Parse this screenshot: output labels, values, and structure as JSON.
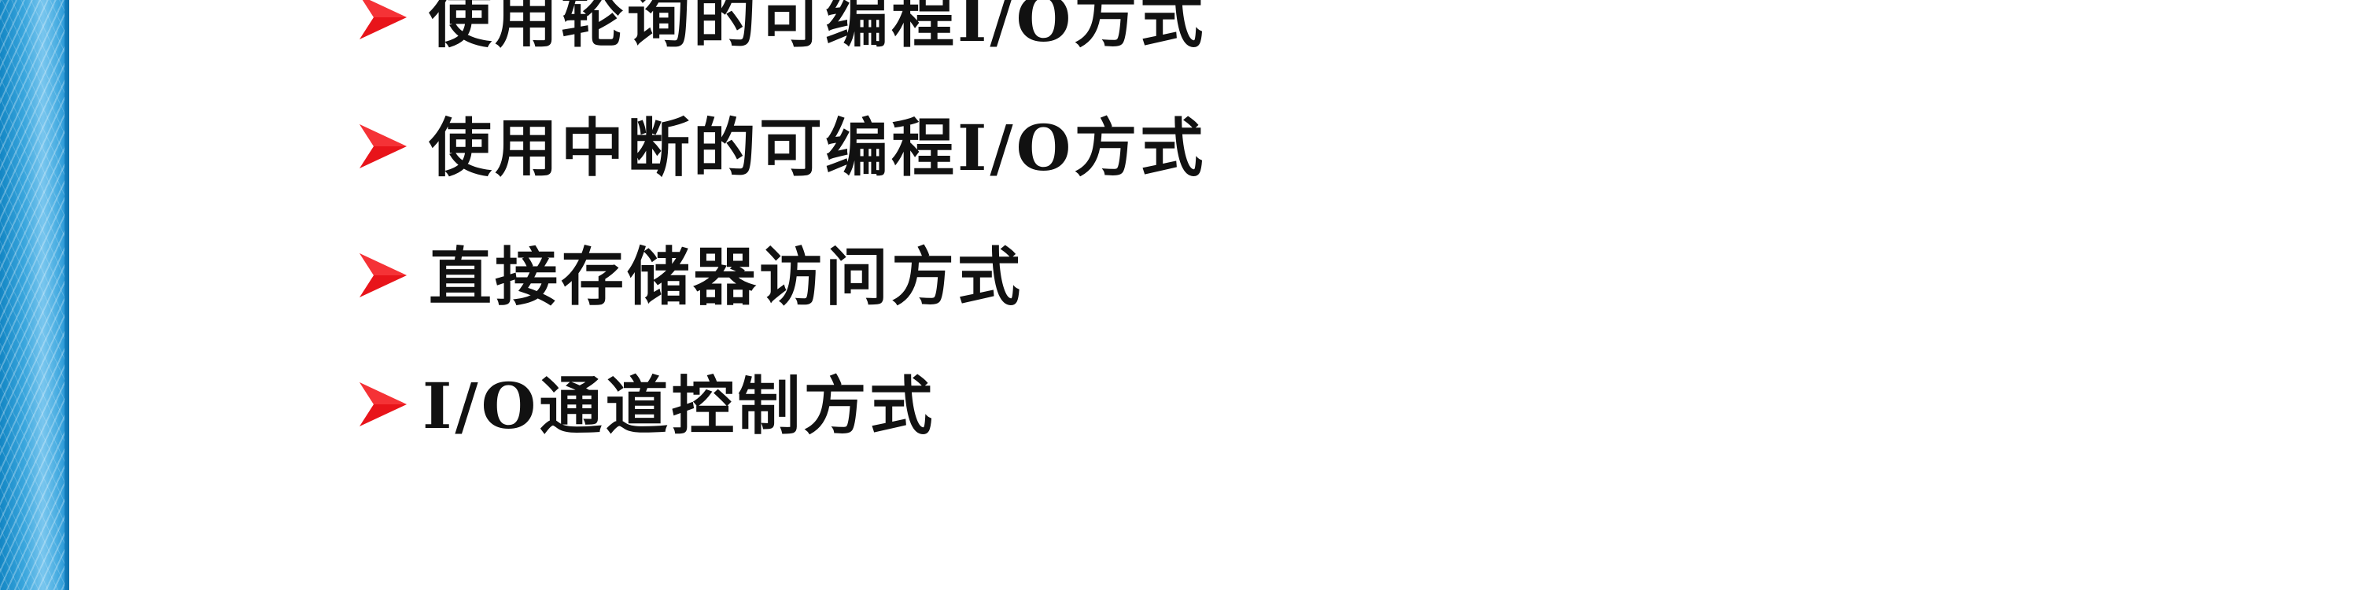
{
  "slide": {
    "colors": {
      "bullet": "#e8141a",
      "text": "#111111",
      "strip": "#3aa6dd"
    },
    "bullet_icon": "red-arrowhead",
    "items": [
      {
        "label": "使用轮询的可编程I/O方式"
      },
      {
        "label": "使用中断的可编程I/O方式"
      },
      {
        "label": "直接存储器访问方式"
      },
      {
        "label": "I/O通道控制方式"
      }
    ]
  }
}
